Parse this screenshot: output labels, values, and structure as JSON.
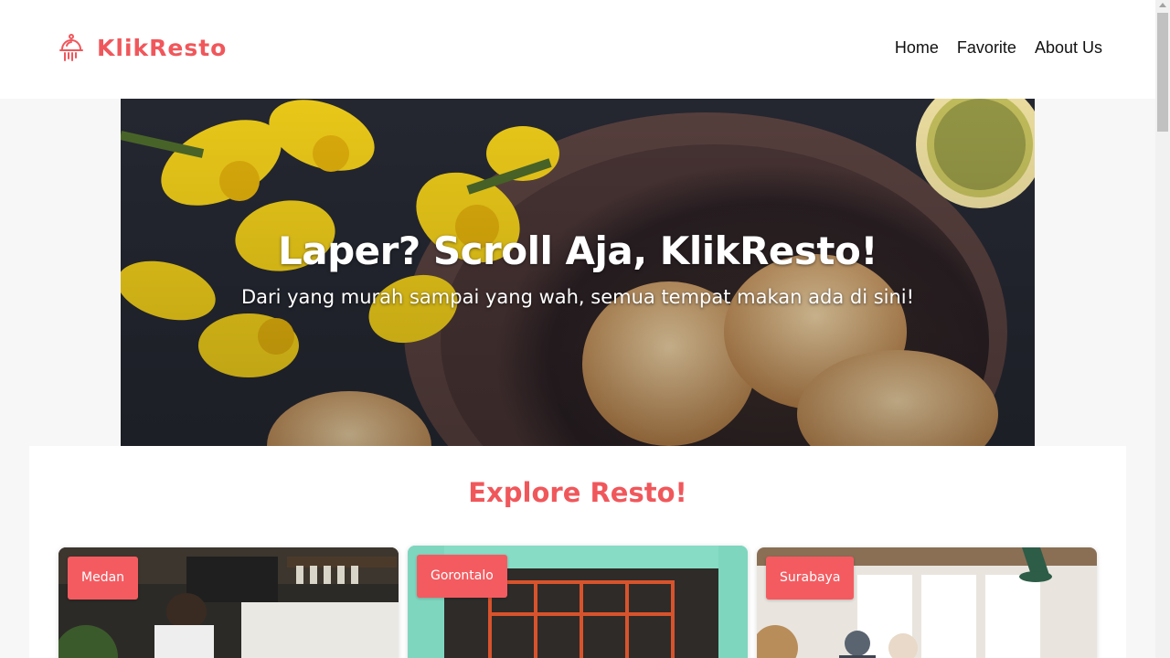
{
  "header": {
    "brand_name": "KlikResto",
    "brand_icon": "restaurant-dome-icon",
    "nav": [
      "Home",
      "Favorite",
      "About Us"
    ]
  },
  "hero": {
    "title": "Laper? Scroll Aja, KlikResto!",
    "subtitle": "Dari yang murah sampai yang wah, semua tempat makan ada di sini!"
  },
  "main": {
    "section_title": "Explore Resto!",
    "cards": [
      {
        "city": "Medan"
      },
      {
        "city": "Gorontalo"
      },
      {
        "city": "Surabaya"
      }
    ]
  },
  "colors": {
    "accent": "#f0575b",
    "badge": "#f45b60",
    "header_bg": "#ffffff",
    "page_bg": "#f7f7f7"
  }
}
